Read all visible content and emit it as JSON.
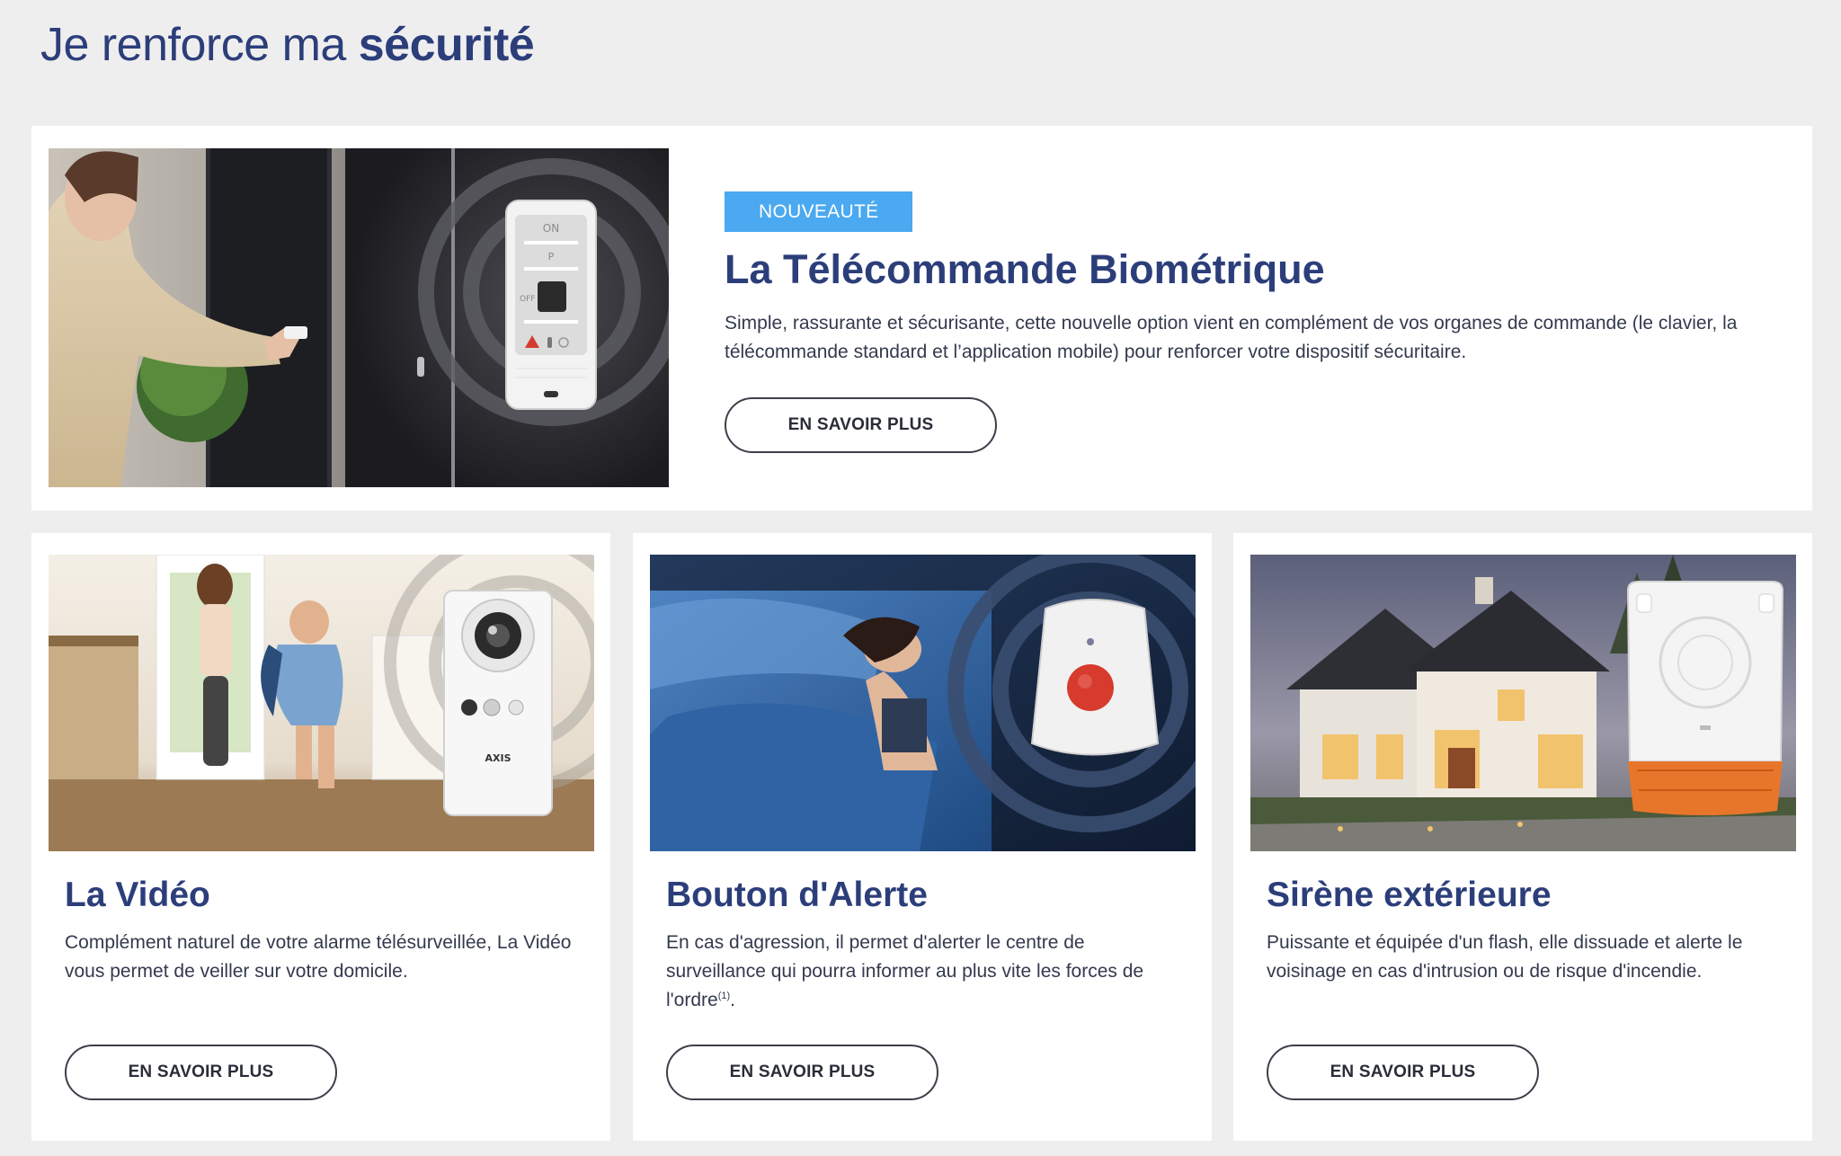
{
  "page": {
    "title_prefix": "Je renforce ma ",
    "title_emphasis": "sécurité"
  },
  "featured": {
    "badge": "NOUVEAUTÉ",
    "title": "La Télécommande Biométrique",
    "description": "Simple, rassurante et sécurisante, cette nouvelle option vient en complément de vos organes de commande (le clavier, la télécommande standard et l’application mobile) pour renforcer votre dispositif sécuritaire.",
    "cta": "EN SAVOIR PLUS",
    "remote_labels": [
      "ON",
      "P",
      "OFF"
    ]
  },
  "cards": [
    {
      "title": "La Vidéo",
      "description": "Complément naturel de votre alarme télésurveillée, La Vidéo vous permet de veiller sur votre domicile.",
      "cta": "EN SAVOIR PLUS",
      "camera_brand": "AXIS"
    },
    {
      "title": "Bouton d'Alerte",
      "description": "En cas d'agression, il permet d'alerter le centre de surveillance qui pourra informer au plus vite les forces de l'ordre",
      "footnote": "(1)",
      "description_end": ".",
      "cta": "EN SAVOIR PLUS"
    },
    {
      "title": "Sirène extérieure",
      "description": "Puissante et équipée d'un flash, elle dissuade et alerte le voisinage en cas d'intrusion ou de risque d'incendie.",
      "cta": "EN SAVOIR PLUS"
    }
  ],
  "colors": {
    "brand_navy": "#2c3e7a",
    "badge_blue": "#4aa9f0",
    "background": "#efeeef",
    "alert_red": "#d63b2e",
    "siren_orange": "#e8762a"
  }
}
